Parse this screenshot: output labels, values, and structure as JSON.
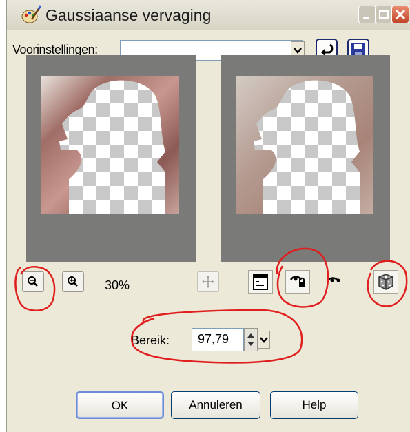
{
  "window": {
    "title": "Gaussiaanse vervaging"
  },
  "presets": {
    "label": "Voorinstellingen:",
    "value": ""
  },
  "zoom": {
    "level": "30%"
  },
  "range": {
    "label": "Bereik:",
    "value": "97,79"
  },
  "buttons": {
    "ok": "OK",
    "cancel": "Annuleren",
    "help": "Help"
  },
  "icons": {
    "app": "palette-icon",
    "reset": "reset-arrow-icon",
    "save": "floppy-disk-icon",
    "zoom_in": "zoom-in-icon",
    "zoom_out": "zoom-out-icon",
    "move": "move-cross-icon",
    "preview_toggle": "preview-window-icon",
    "proof": "proof-eye-lock-icon",
    "auto_proof": "auto-proof-eye-icon",
    "randomize": "dice-icon"
  },
  "colors": {
    "annotation": "#e01e1e",
    "dialog_bg": "#ece9d8",
    "preview_bg": "#7a7a78"
  }
}
